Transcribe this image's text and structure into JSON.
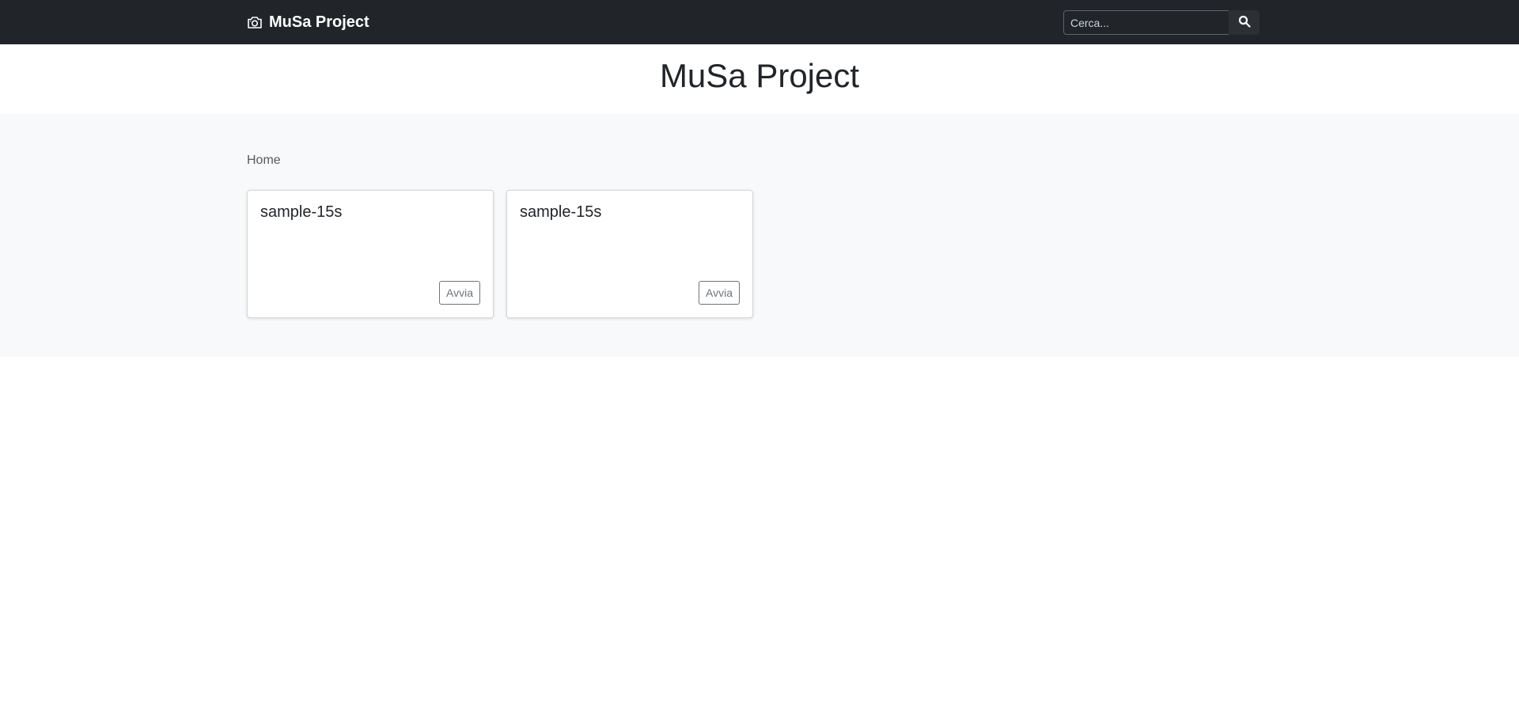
{
  "navbar": {
    "brand": "MuSa Project",
    "brand_icon": "camera-icon",
    "search": {
      "placeholder": "Cerca...",
      "value": "",
      "button_icon": "search-icon"
    }
  },
  "hero": {
    "title": "MuSa Project"
  },
  "breadcrumb": "Home",
  "cards": [
    {
      "title": "sample-15s",
      "button": "Avvia"
    },
    {
      "title": "sample-15s",
      "button": "Avvia"
    }
  ],
  "colors": {
    "navbar_bg": "#212529",
    "main_bg": "#f8f9fa",
    "button_outline": "#6c757d"
  }
}
